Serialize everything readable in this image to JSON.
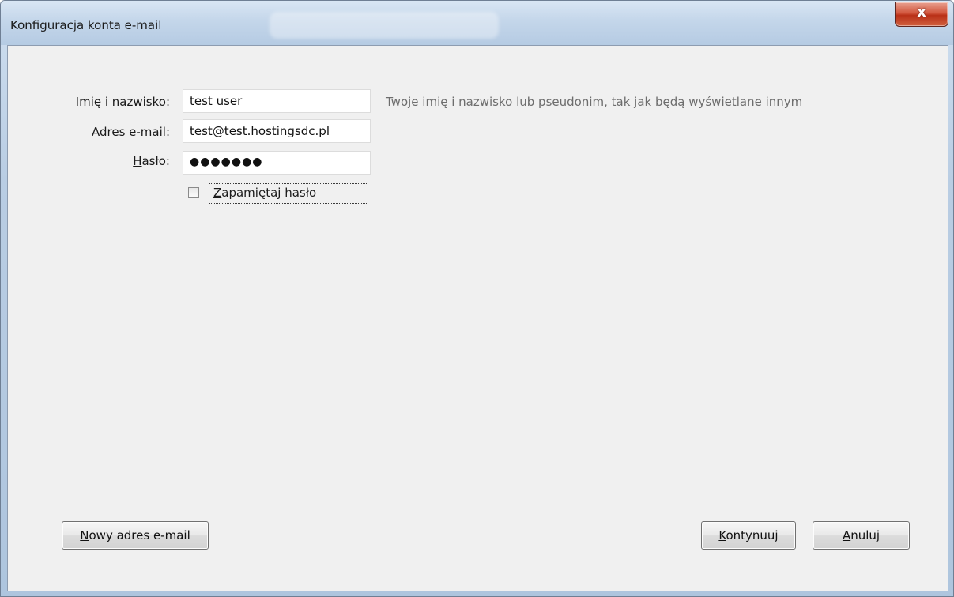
{
  "window": {
    "title": "Konfiguracja konta e-mail",
    "close_label": "x"
  },
  "form": {
    "name": {
      "label_underlined": "I",
      "label_rest": "mię i nazwisko:",
      "value": "test user",
      "hint": "Twoje imię i nazwisko lub pseudonim, tak jak będą wyświetlane innym"
    },
    "email": {
      "label_pre": "Adre",
      "label_underlined": "s",
      "label_post": " e-mail:",
      "value": "test@test.hostingsdc.pl"
    },
    "password": {
      "label_underlined": "H",
      "label_rest": "asło:",
      "value_masked": "●●●●●●●"
    },
    "remember": {
      "label_underlined": "Z",
      "label_rest": "apamiętaj hasło",
      "checked": false
    }
  },
  "buttons": {
    "new_address": {
      "underlined": "N",
      "rest": "owy adres e-mail"
    },
    "continue": {
      "underlined": "K",
      "rest": "ontynuuj"
    },
    "cancel": {
      "underlined": "A",
      "rest": "nuluj"
    }
  },
  "colors": {
    "close_button": "#c7422a",
    "client_background": "#f0f0f0",
    "hint_text": "#6d6d6d"
  }
}
